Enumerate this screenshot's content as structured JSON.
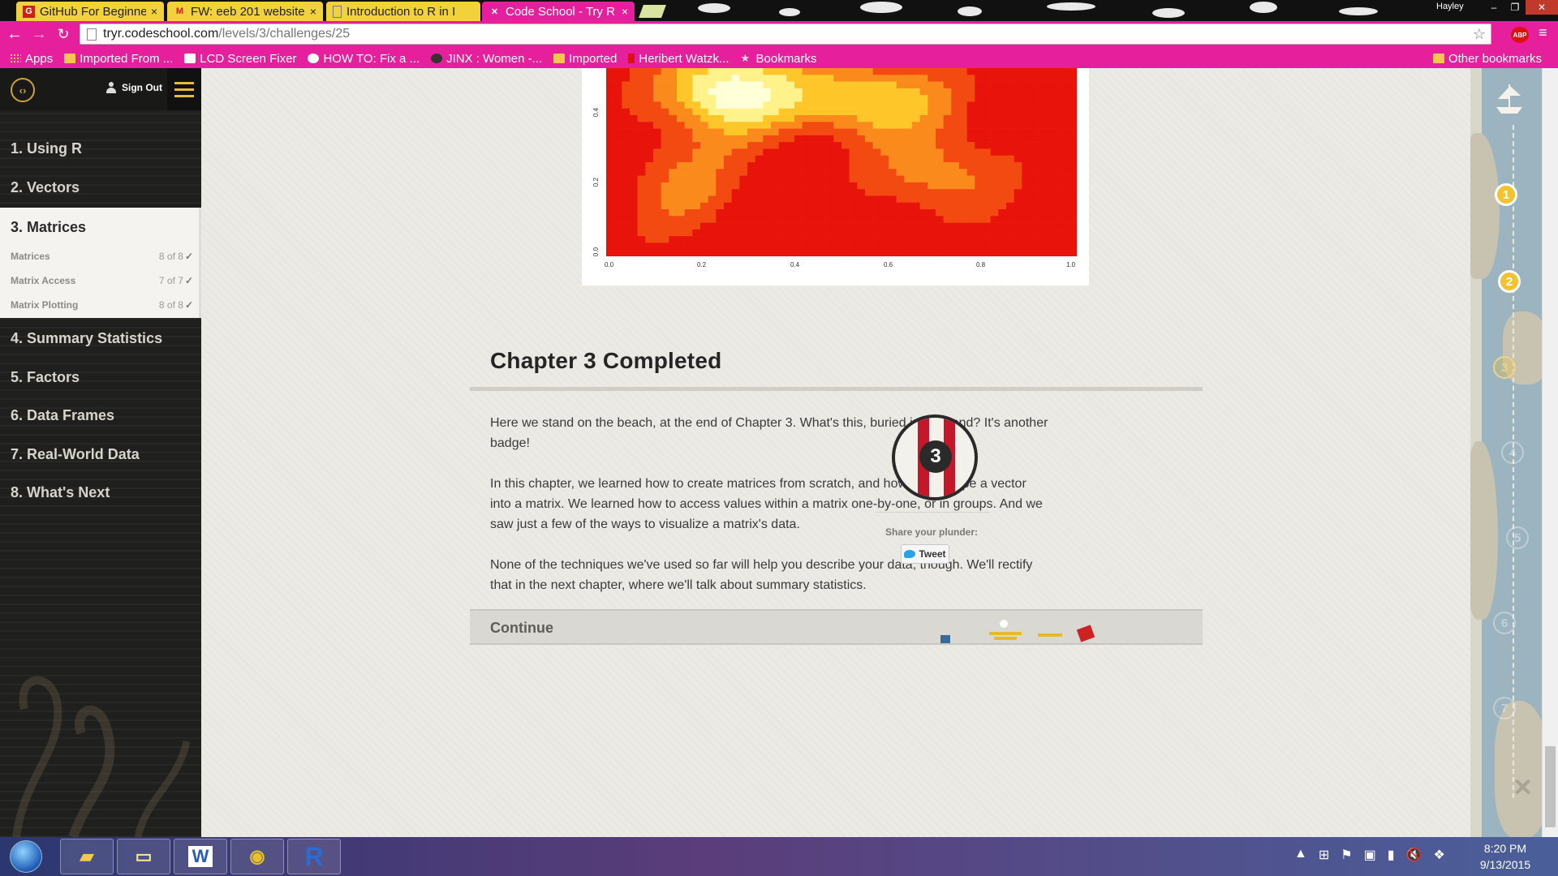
{
  "browser": {
    "tabs": [
      {
        "label": "GitHub For Beginner",
        "icon": "github-icon",
        "active": false
      },
      {
        "label": "FW: eeb 201 website",
        "icon": "gmail-icon",
        "active": false
      },
      {
        "label": "Introduction to R in I",
        "icon": "page-icon",
        "active": false
      },
      {
        "label": "Code School - Try R",
        "icon": "codeschool-icon",
        "active": true
      }
    ],
    "window_user": "Hayley",
    "url_host": "tryr.codeschool.com",
    "url_path": "/levels/3/challenges/25",
    "extension_label": "ABP"
  },
  "bookmarks": {
    "items": [
      {
        "label": "Apps",
        "icon": "apps-grid-icon"
      },
      {
        "label": "Imported From ...",
        "icon": "folder-icon"
      },
      {
        "label": "LCD Screen Fixer",
        "icon": "bookmark-icon"
      },
      {
        "label": "HOW TO: Fix a ...",
        "icon": "bookmark-icon"
      },
      {
        "label": "JINX : Women -...",
        "icon": "bookmark-icon"
      },
      {
        "label": "Imported",
        "icon": "folder-icon"
      },
      {
        "label": "Heribert Watzk...",
        "icon": "bookmark-icon"
      },
      {
        "label": "Bookmarks",
        "icon": "star-icon"
      }
    ],
    "other": "Other bookmarks"
  },
  "sidebar": {
    "signout_label": "Sign Out",
    "levels_before": [
      {
        "label": "1. Using R"
      },
      {
        "label": "2. Vectors"
      }
    ],
    "active_level": {
      "label": "3. Matrices",
      "challenges": [
        {
          "label": "Matrices",
          "progress": "8 of 8"
        },
        {
          "label": "Matrix Access",
          "progress": "7 of 7"
        },
        {
          "label": "Matrix Plotting",
          "progress": "8 of 8"
        }
      ]
    },
    "levels_after": [
      {
        "label": "4. Summary Statistics"
      },
      {
        "label": "5. Factors"
      },
      {
        "label": "6. Data Frames"
      },
      {
        "label": "7. Real-World Data"
      },
      {
        "label": "8. What's Next"
      }
    ]
  },
  "plot": {
    "x_ticks": [
      "0.0",
      "0.2",
      "0.4",
      "0.6",
      "0.8",
      "1.0"
    ],
    "y_ticks": [
      "0.4",
      "0.2",
      "0.0"
    ],
    "palette": [
      "#e8140c",
      "#f24a10",
      "#fa8a1c",
      "#ffc62a",
      "#fff28a",
      "#ffffd8"
    ]
  },
  "chapter": {
    "title": "Chapter 3 Completed",
    "paragraphs": [
      "Here we stand on the beach, at the end of Chapter 3. What's this, buried in the sand? It's another badge!",
      "In this chapter, we learned how to create matrices from scratch, and how to re-shape a vector into a matrix. We learned how to access values within a matrix one-by-one, or in groups. And we saw just a few of the ways to visualize a matrix's data.",
      "None of the techniques we've used so far will help you describe your data, though. We'll rectify that in the next chapter, where we'll talk about summary statistics."
    ],
    "badge_number": "3",
    "share_label": "Share your plunder:",
    "tweet_label": "Tweet",
    "continue_label": "Continue"
  },
  "map": {
    "pins": [
      {
        "label": "1",
        "state": "done"
      },
      {
        "label": "2",
        "state": "done"
      },
      {
        "label": "3",
        "state": "current"
      },
      {
        "label": "4",
        "state": "todo"
      },
      {
        "label": "5",
        "state": "todo"
      },
      {
        "label": "6",
        "state": "todo"
      },
      {
        "label": "7",
        "state": "todo"
      }
    ]
  },
  "taskbar": {
    "apps": [
      {
        "name": "file-explorer-icon",
        "glyph": "📁"
      },
      {
        "name": "sticky-notes-icon",
        "glyph": "▭"
      },
      {
        "name": "word-icon",
        "glyph": "W"
      },
      {
        "name": "chrome-icon",
        "glyph": "◉"
      },
      {
        "name": "r-icon",
        "glyph": "R"
      }
    ],
    "time": "8:20 PM",
    "date": "9/13/2015"
  },
  "colors": {
    "chrome_accent": "#e6209c",
    "badge_red": "#c4182a",
    "map_gold": "#f2c230"
  }
}
